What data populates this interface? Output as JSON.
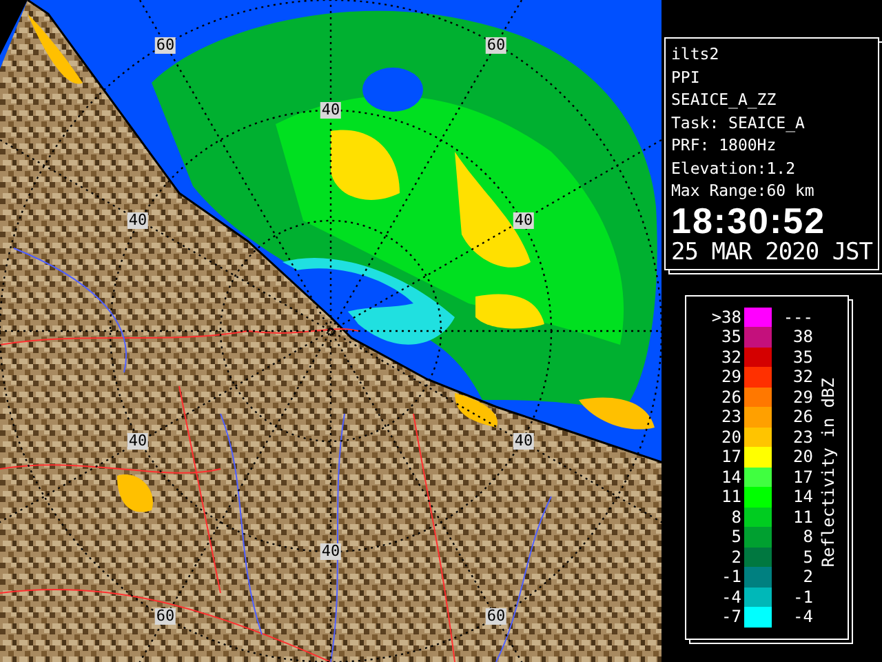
{
  "radar_map": {
    "range_labels": [
      "60",
      "60",
      "40",
      "40",
      "40",
      "40",
      "40",
      "40",
      "60",
      "60"
    ]
  },
  "info_panel": {
    "lines": [
      "ilts2",
      "PPI",
      "SEAICE_A_ZZ",
      "Task: SEAICE_A",
      "PRF: 1800Hz",
      "Elevation:1.2",
      "Max Range:60 km"
    ],
    "time": "18:30:52",
    "date": "25 MAR 2020 JST"
  },
  "legend": {
    "title": "Reflectivity in dBZ",
    "bins": [
      {
        "low": ">38",
        "high": "---",
        "color": "#ff00ff"
      },
      {
        "low": "35",
        "high": "38",
        "color": "#c4107c"
      },
      {
        "low": "32",
        "high": "35",
        "color": "#d40000"
      },
      {
        "low": "29",
        "high": "32",
        "color": "#ff3000"
      },
      {
        "low": "26",
        "high": "29",
        "color": "#ff7800"
      },
      {
        "low": "23",
        "high": "26",
        "color": "#ffa000"
      },
      {
        "low": "20",
        "high": "23",
        "color": "#ffc400"
      },
      {
        "low": "17",
        "high": "20",
        "color": "#ffff00"
      },
      {
        "low": "14",
        "high": "17",
        "color": "#40ff40"
      },
      {
        "low": "11",
        "high": "14",
        "color": "#00ff00"
      },
      {
        "low": "8",
        "high": "11",
        "color": "#00cc20"
      },
      {
        "low": "5",
        "high": "8",
        "color": "#00a030"
      },
      {
        "low": "2",
        "high": "5",
        "color": "#007840"
      },
      {
        "low": "-1",
        "high": "2",
        "color": "#008080"
      },
      {
        "low": "-4",
        "high": "-1",
        "color": "#00b8b8"
      },
      {
        "low": "-7",
        "high": "-4",
        "color": "#00ffff"
      }
    ]
  }
}
